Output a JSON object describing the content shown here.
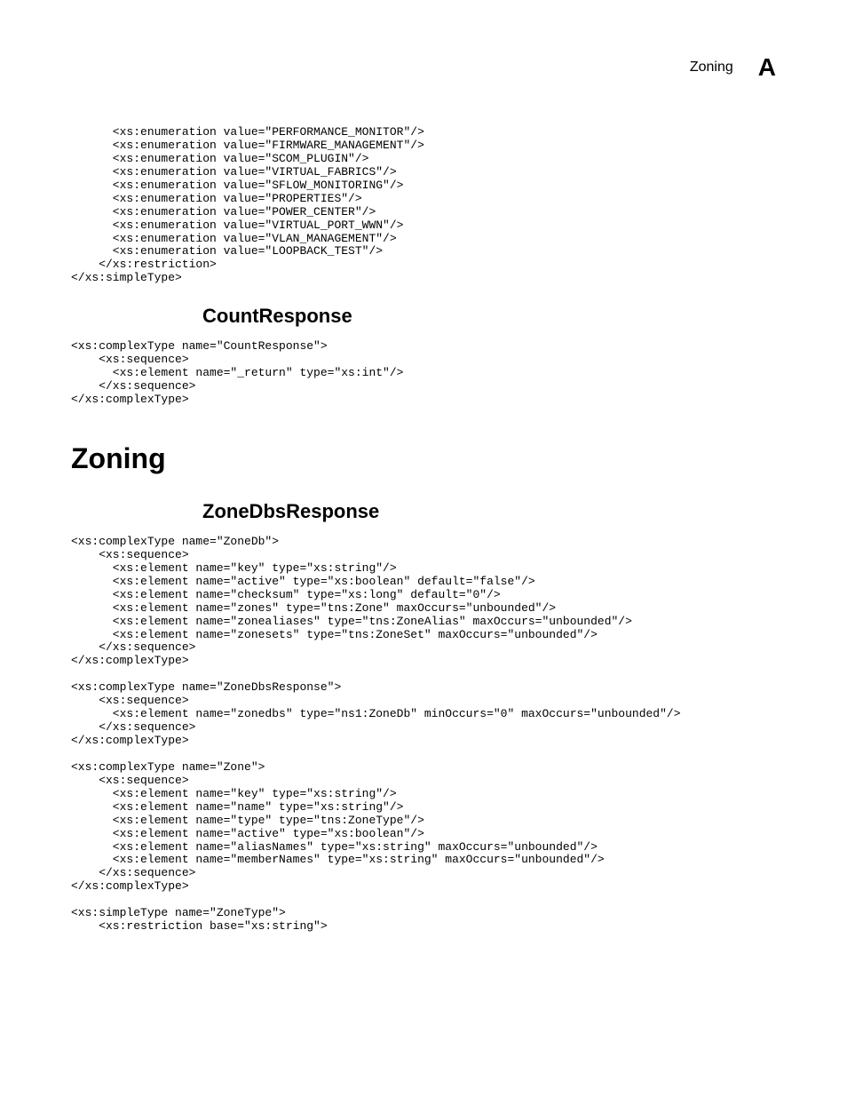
{
  "header": {
    "title": "Zoning",
    "badge": "A"
  },
  "code1": "      <xs:enumeration value=\"PERFORMANCE_MONITOR\"/>\n      <xs:enumeration value=\"FIRMWARE_MANAGEMENT\"/>\n      <xs:enumeration value=\"SCOM_PLUGIN\"/>\n      <xs:enumeration value=\"VIRTUAL_FABRICS\"/>\n      <xs:enumeration value=\"SFLOW_MONITORING\"/>\n      <xs:enumeration value=\"PROPERTIES\"/>\n      <xs:enumeration value=\"POWER_CENTER\"/>\n      <xs:enumeration value=\"VIRTUAL_PORT_WWN\"/>\n      <xs:enumeration value=\"VLAN_MANAGEMENT\"/>\n      <xs:enumeration value=\"LOOPBACK_TEST\"/>\n    </xs:restriction>\n</xs:simpleType>",
  "heading1": "CountResponse",
  "code2": "<xs:complexType name=\"CountResponse\">\n    <xs:sequence>\n      <xs:element name=\"_return\" type=\"xs:int\"/>\n    </xs:sequence>\n</xs:complexType>",
  "heading2": "Zoning",
  "heading3": "ZoneDbsResponse",
  "code3": "<xs:complexType name=\"ZoneDb\">\n    <xs:sequence>\n      <xs:element name=\"key\" type=\"xs:string\"/>\n      <xs:element name=\"active\" type=\"xs:boolean\" default=\"false\"/>\n      <xs:element name=\"checksum\" type=\"xs:long\" default=\"0\"/>\n      <xs:element name=\"zones\" type=\"tns:Zone\" maxOccurs=\"unbounded\"/>\n      <xs:element name=\"zonealiases\" type=\"tns:ZoneAlias\" maxOccurs=\"unbounded\"/>\n      <xs:element name=\"zonesets\" type=\"tns:ZoneSet\" maxOccurs=\"unbounded\"/>\n    </xs:sequence>\n</xs:complexType>\n\n<xs:complexType name=\"ZoneDbsResponse\">\n    <xs:sequence>\n      <xs:element name=\"zonedbs\" type=\"ns1:ZoneDb\" minOccurs=\"0\" maxOccurs=\"unbounded\"/>\n    </xs:sequence>\n</xs:complexType>\n\n<xs:complexType name=\"Zone\">\n    <xs:sequence>\n      <xs:element name=\"key\" type=\"xs:string\"/>\n      <xs:element name=\"name\" type=\"xs:string\"/>\n      <xs:element name=\"type\" type=\"tns:ZoneType\"/>\n      <xs:element name=\"active\" type=\"xs:boolean\"/>\n      <xs:element name=\"aliasNames\" type=\"xs:string\" maxOccurs=\"unbounded\"/>\n      <xs:element name=\"memberNames\" type=\"xs:string\" maxOccurs=\"unbounded\"/>\n    </xs:sequence>\n</xs:complexType>\n\n<xs:simpleType name=\"ZoneType\">\n    <xs:restriction base=\"xs:string\">"
}
